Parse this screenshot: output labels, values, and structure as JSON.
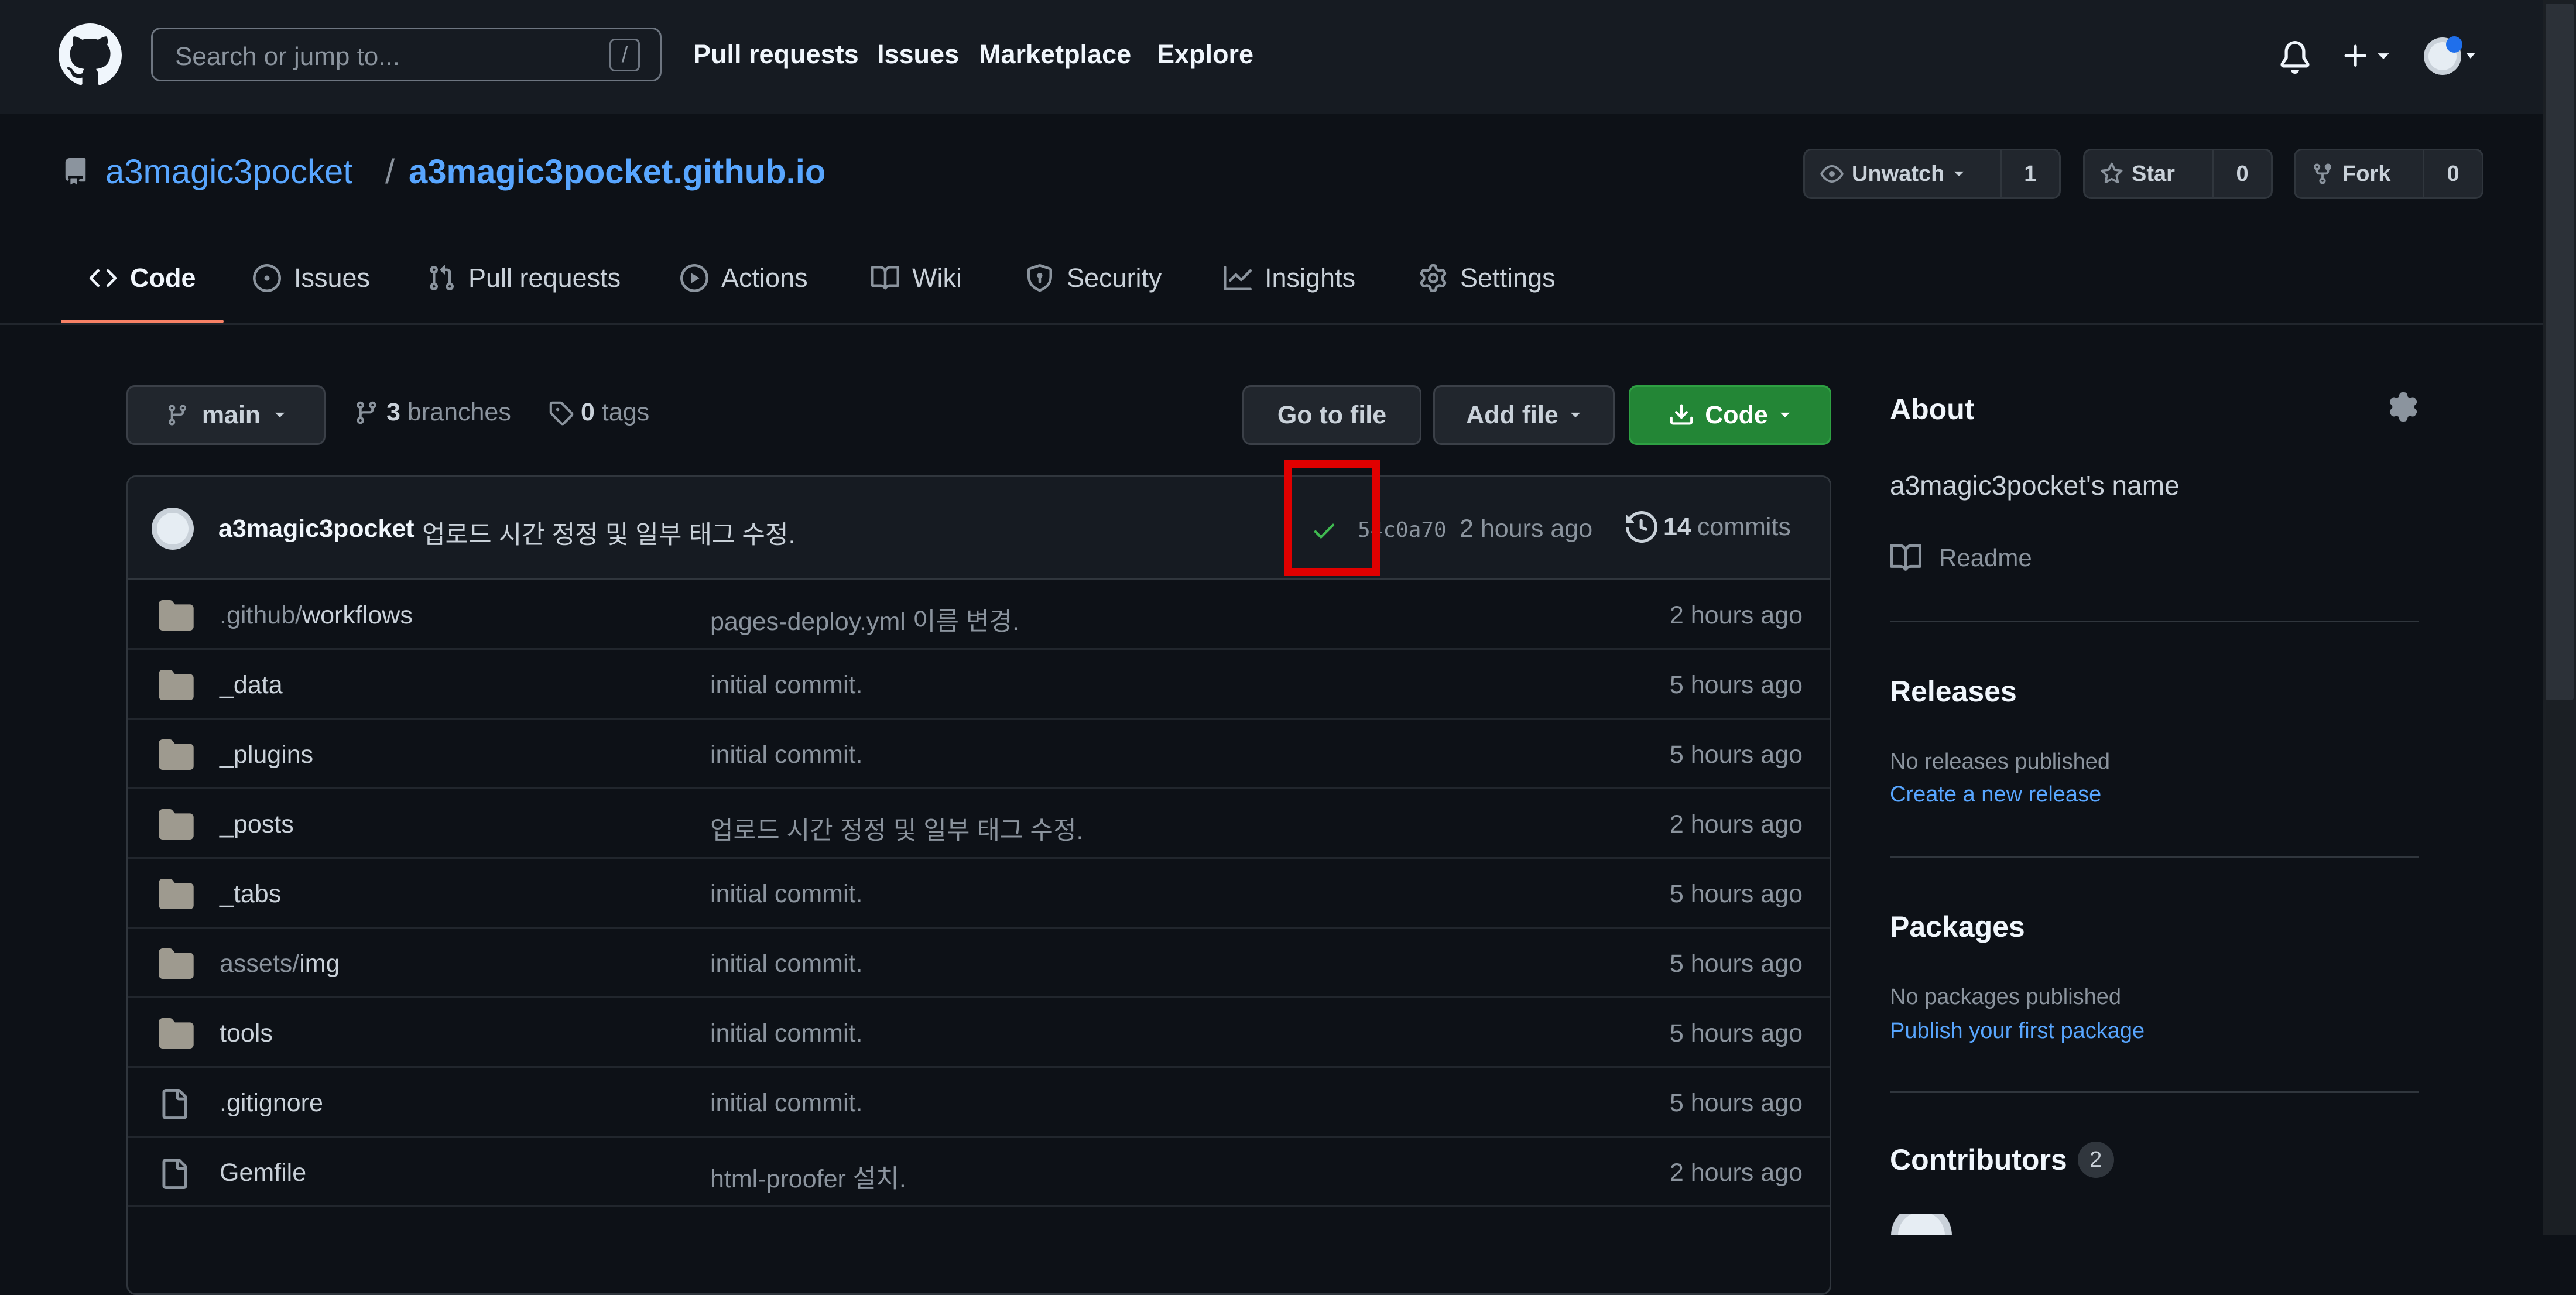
{
  "nav": {
    "search_placeholder": "Search or jump to...",
    "search_shortcut": "/",
    "links": [
      "Pull requests",
      "Issues",
      "Marketplace",
      "Explore"
    ]
  },
  "repo": {
    "owner": "a3magic3pocket",
    "separator": "/",
    "name": "a3magic3pocket.github.io",
    "watch_label": "Unwatch",
    "watch_count": "1",
    "star_label": "Star",
    "star_count": "0",
    "fork_label": "Fork",
    "fork_count": "0"
  },
  "tabs": [
    "Code",
    "Issues",
    "Pull requests",
    "Actions",
    "Wiki",
    "Security",
    "Insights",
    "Settings"
  ],
  "toolbar": {
    "branch": "main",
    "branches_count": "3",
    "branches_label": "branches",
    "tags_count": "0",
    "tags_label": "tags",
    "go_to_file": "Go to file",
    "add_file": "Add file",
    "code": "Code"
  },
  "latest_commit": {
    "author": "a3magic3pocket",
    "message": "업로드 시간 정정 및 일부 태그 수정.",
    "sha": "54c0a70",
    "time": "2 hours ago",
    "commits_count": "14",
    "commits_label": "commits"
  },
  "files": [
    {
      "type": "dir",
      "prefix": ".github/",
      "name": "workflows",
      "message": "pages-deploy.yml 이름 변경.",
      "time": "2 hours ago"
    },
    {
      "type": "dir",
      "prefix": "",
      "name": "_data",
      "message": "initial commit.",
      "time": "5 hours ago"
    },
    {
      "type": "dir",
      "prefix": "",
      "name": "_plugins",
      "message": "initial commit.",
      "time": "5 hours ago"
    },
    {
      "type": "dir",
      "prefix": "",
      "name": "_posts",
      "message": "업로드 시간 정정 및 일부 태그 수정.",
      "time": "2 hours ago"
    },
    {
      "type": "dir",
      "prefix": "",
      "name": "_tabs",
      "message": "initial commit.",
      "time": "5 hours ago"
    },
    {
      "type": "dir",
      "prefix": "assets/",
      "name": "img",
      "message": "initial commit.",
      "time": "5 hours ago"
    },
    {
      "type": "dir",
      "prefix": "",
      "name": "tools",
      "message": "initial commit.",
      "time": "5 hours ago"
    },
    {
      "type": "file",
      "prefix": "",
      "name": ".gitignore",
      "message": "initial commit.",
      "time": "5 hours ago"
    },
    {
      "type": "file",
      "prefix": "",
      "name": "Gemfile",
      "message": "html-proofer 설치.",
      "time": "2 hours ago"
    }
  ],
  "sidebar": {
    "about_title": "About",
    "about_desc": "a3magic3pocket's name",
    "readme": "Readme",
    "releases_title": "Releases",
    "releases_none": "No releases published",
    "releases_link": "Create a new release",
    "packages_title": "Packages",
    "packages_none": "No packages published",
    "packages_link": "Publish your first package",
    "contributors_title": "Contributors",
    "contributors_count": "2"
  },
  "colors": {
    "background": "#0d1117",
    "header": "#161b22",
    "link": "#58a6ff",
    "primary_button": "#238636",
    "tab_underline": "#f78166",
    "highlight": "#e00000"
  }
}
